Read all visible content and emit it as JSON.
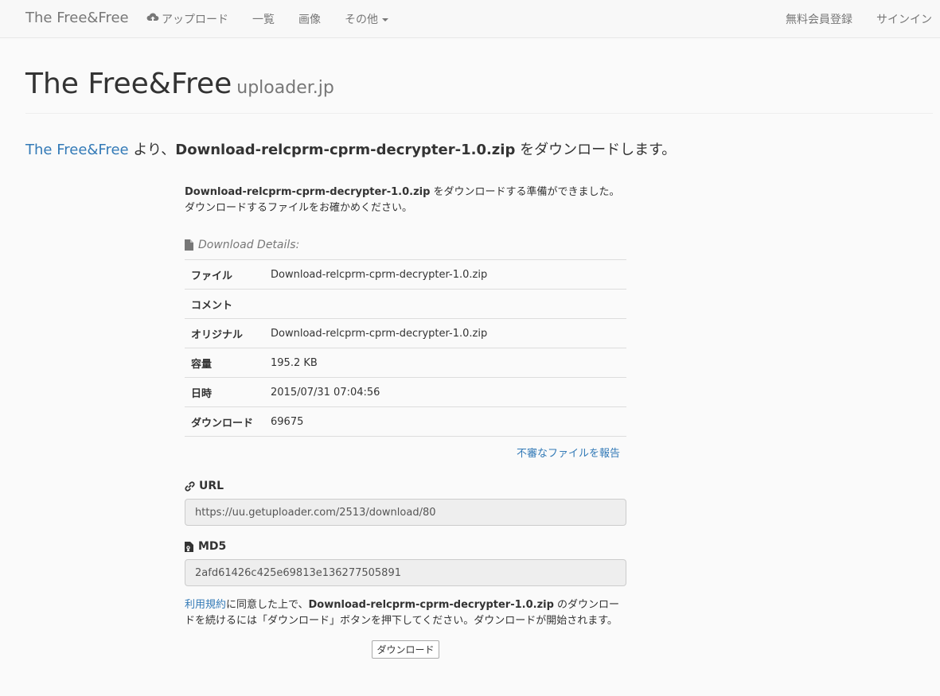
{
  "nav": {
    "brand": "The Free&Free",
    "upload": "アップロード",
    "list": "一覧",
    "images": "画像",
    "others": "その他",
    "register": "無料会員登録",
    "signin": "サインイン"
  },
  "header": {
    "title": "The Free&Free",
    "subtitle": "uploader.jp"
  },
  "lead": {
    "site_link": "The Free&Free",
    "part1": " より、",
    "filename": "Download-relcprm-cprm-decrypter-1.0.zip",
    "part2": " をダウンロードします。"
  },
  "intro": {
    "filename": "Download-relcprm-cprm-decrypter-1.0.zip",
    "text": " をダウンロードする準備ができました。ダウンロードするファイルをお確かめください。"
  },
  "details": {
    "heading": "Download Details:",
    "rows": [
      {
        "key": "ファイル",
        "value": "Download-relcprm-cprm-decrypter-1.0.zip"
      },
      {
        "key": "コメント",
        "value": ""
      },
      {
        "key": "オリジナル",
        "value": "Download-relcprm-cprm-decrypter-1.0.zip"
      },
      {
        "key": "容量",
        "value": "195.2 KB"
      },
      {
        "key": "日時",
        "value": "2015/07/31 07:04:56"
      },
      {
        "key": "ダウンロード",
        "value": "69675"
      }
    ],
    "report_link": "不審なファイルを報告"
  },
  "url": {
    "label": "URL",
    "value": "https://uu.getuploader.com/2513/download/80"
  },
  "md5": {
    "label": "MD5",
    "value": "2afd61426c425e69813e136277505891"
  },
  "terms": {
    "link": "利用規約",
    "part1": "に同意した上で、",
    "filename": "Download-relcprm-cprm-decrypter-1.0.zip",
    "part2": " のダウンロードを続けるには「ダウンロード」ボタンを押下してください。ダウンロードが開始されます。"
  },
  "download_button": "ダウンロード"
}
